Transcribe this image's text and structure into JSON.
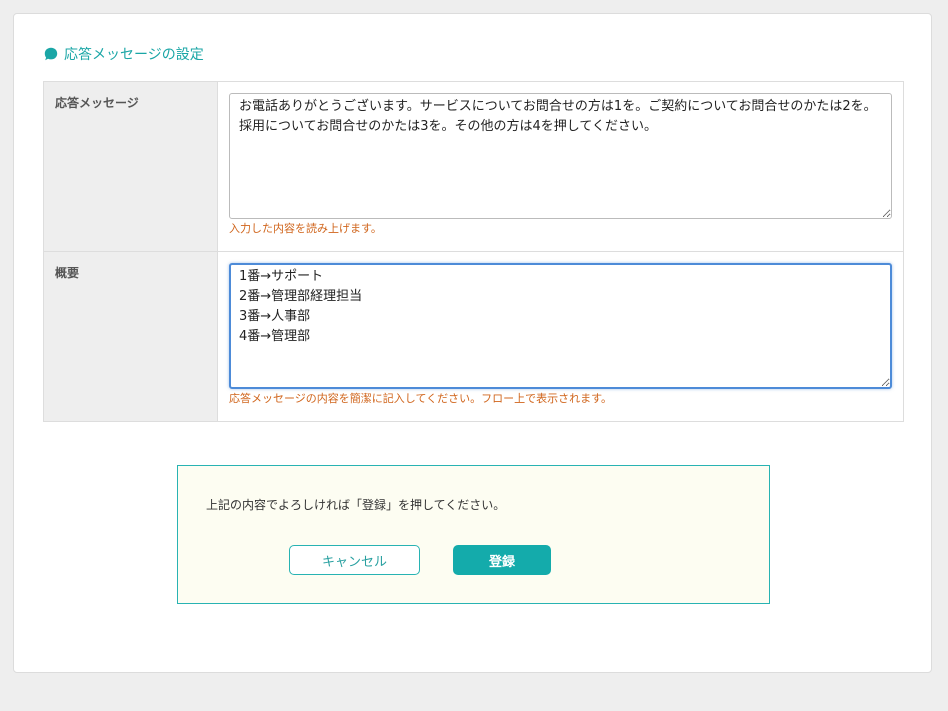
{
  "section": {
    "title": "応答メッセージの設定",
    "accent_color": "#1aa6a6",
    "icon": "speech-bubble-icon"
  },
  "form": {
    "rows": [
      {
        "label": "応答メッセージ",
        "value": "お電話ありがとうございます。サービスについてお問合せの方は1を。ご契約についてお問合せのかたは2を。採用についてお問合せのかたは3を。その他の方は4を押してください。",
        "hint": "入力した内容を読み上げます。"
      },
      {
        "label": "概要",
        "value": "1番→サポート\n2番→管理部経理担当\n3番→人事部\n4番→管理部",
        "hint": "応答メッセージの内容を簡潔に記入してください。フロー上で表示されます。"
      }
    ],
    "hint_color": "#d0651c"
  },
  "confirm": {
    "text": "上記の内容でよろしければ「登録」を押してください。",
    "cancel_label": "キャンセル",
    "register_label": "登録",
    "button_color": "#14abab"
  }
}
